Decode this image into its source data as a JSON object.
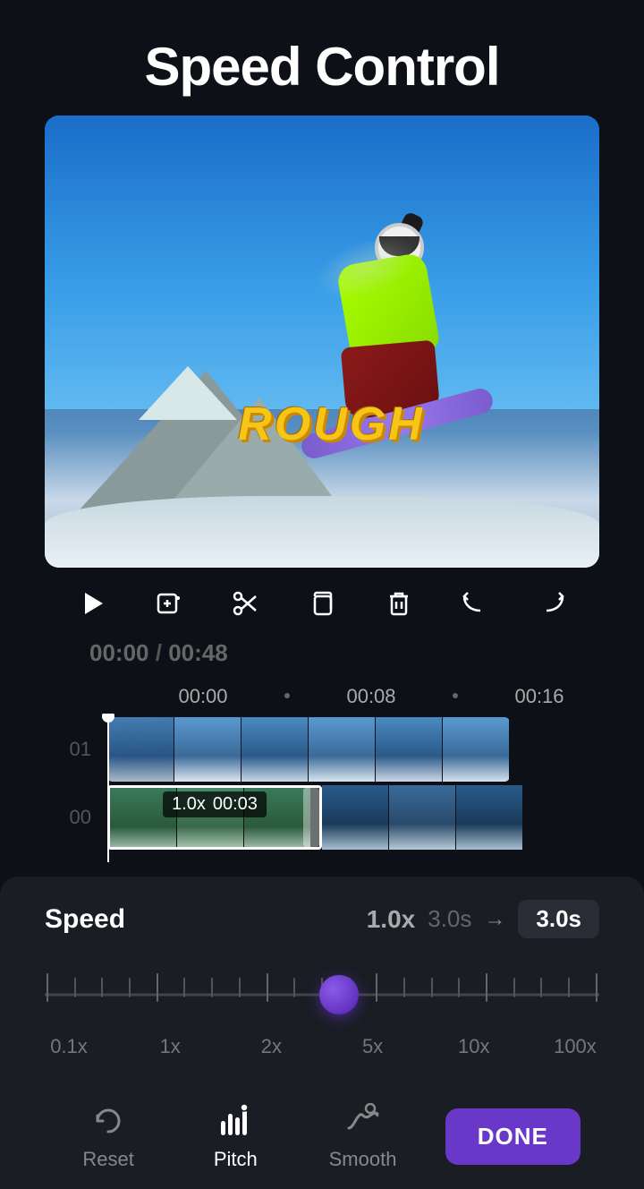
{
  "header": {
    "title": "Speed Control"
  },
  "toolbar": {
    "play_label": "Play",
    "add_clip_label": "Add Clip",
    "cut_label": "Cut",
    "copy_label": "Copy",
    "delete_label": "Delete",
    "undo_label": "Undo",
    "redo_label": "Redo"
  },
  "timeline": {
    "current_time": "00:00",
    "total_time": "00:48",
    "markers": [
      "00:00",
      "00:08",
      "00:16"
    ],
    "track_labels": [
      "01",
      "00"
    ],
    "segment_speed": "1.0x",
    "segment_duration": "00:03"
  },
  "speed": {
    "label": "Speed",
    "current_value": "1.0x",
    "duration_from": "3.0s",
    "arrow": "→",
    "duration_to": "3.0s",
    "slider_labels": [
      "0.1x",
      "1x",
      "2x",
      "5x",
      "10x",
      "100x"
    ]
  },
  "bottom_tools": {
    "reset": {
      "label": "Reset",
      "active": false
    },
    "pitch": {
      "label": "Pitch",
      "active": true
    },
    "smooth": {
      "label": "Smooth",
      "active": false
    },
    "done": "DONE"
  },
  "video": {
    "watermark": "ROUGH"
  }
}
